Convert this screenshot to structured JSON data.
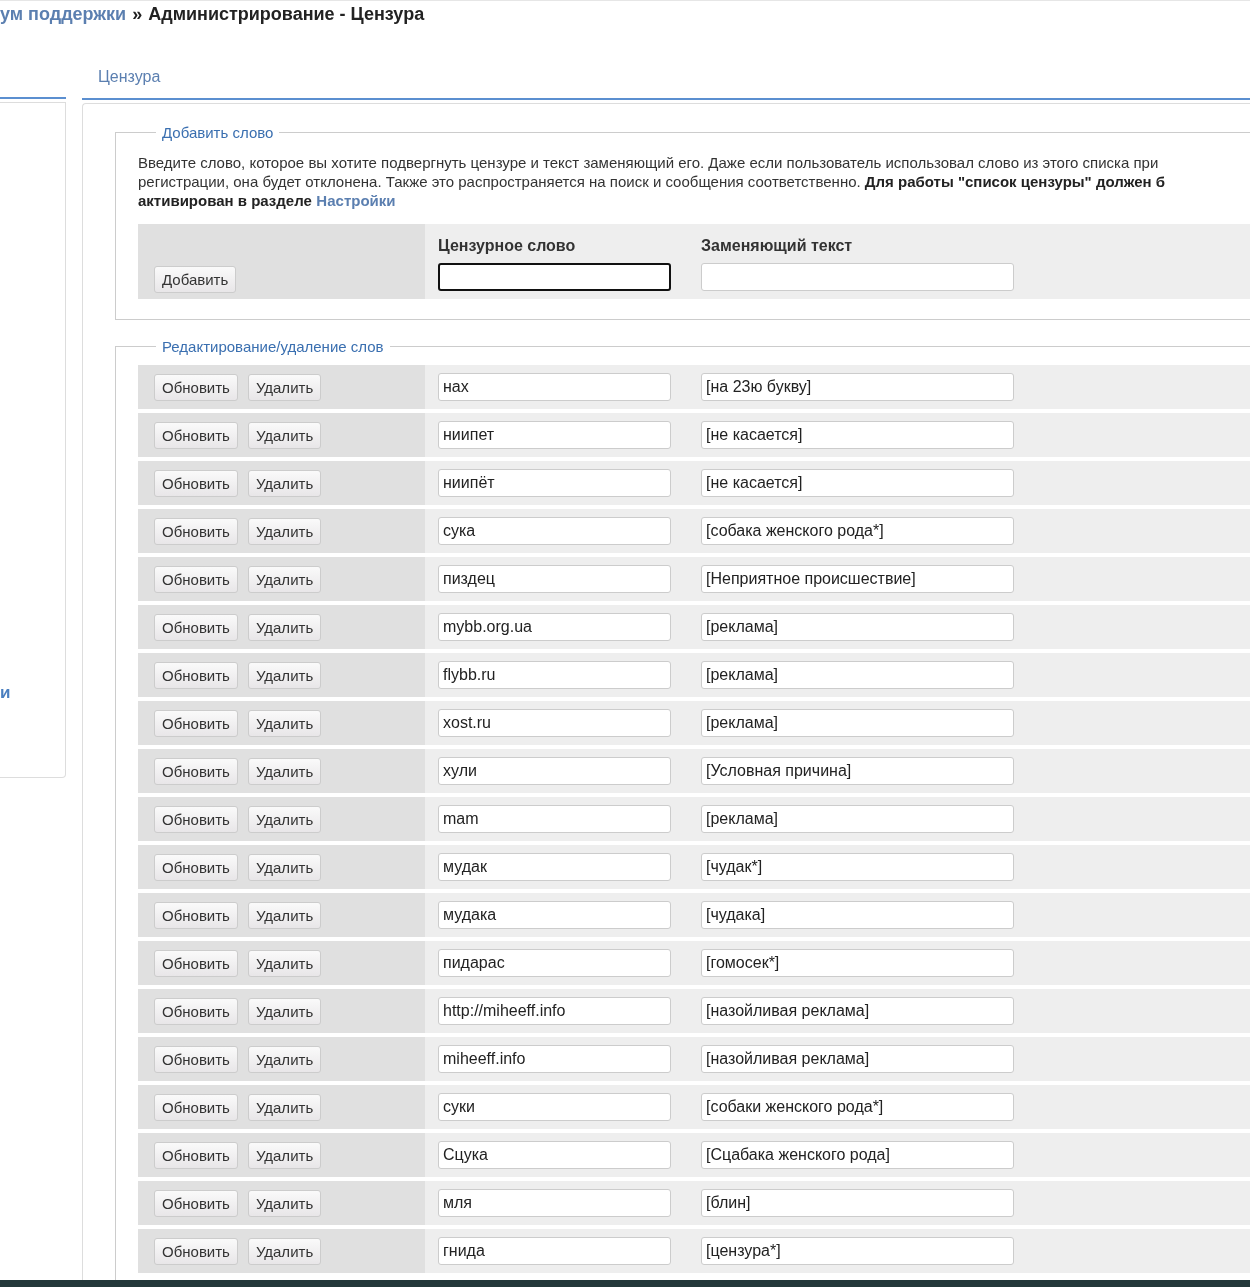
{
  "breadcrumb": {
    "link": "ум поддержки",
    "separator": "»",
    "current": "Администрирование - Цензура"
  },
  "sidebar": {
    "link": "и"
  },
  "tabs": [
    {
      "label": "Цензура",
      "selected": true
    }
  ],
  "add_section": {
    "legend": "Добавить слово",
    "description": [
      "Введите слово, которое вы хотите подвергнуть цензуре и текст заменяющий его. Даже если пользователь использовал слово из этого списка при",
      "регистрации, она будет отклонена. Также это распространяется на поиск и сообщения соответственно. **Для работы \"список цензуры\" должен б**",
      "**активирован в разделе**"
    ],
    "description_link": "Настройки",
    "button": "Добавить",
    "columns": [
      {
        "header": "Цензурное слово",
        "focused": true
      },
      {
        "header": "Заменяющий текст",
        "focused": false
      }
    ]
  },
  "edit_section": {
    "legend": "Редактирование/удаление слов",
    "rows": [
      {
        "update": "Обновить",
        "delete": "Удалить",
        "word": "нах",
        "replacement": "[на 23ю букву]"
      },
      {
        "update": "Обновить",
        "delete": "Удалить",
        "word": "ниипет",
        "replacement": "[не касается]"
      },
      {
        "update": "Обновить",
        "delete": "Удалить",
        "word": "ниипёт",
        "replacement": "[не касается]"
      },
      {
        "update": "Обновить",
        "delete": "Удалить",
        "word": "сука",
        "replacement": "[собака женского рода*]"
      },
      {
        "update": "Обновить",
        "delete": "Удалить",
        "word": "пиздец",
        "replacement": "[Неприятное происшествие]"
      },
      {
        "update": "Обновить",
        "delete": "Удалить",
        "word": "mybb.org.ua",
        "replacement": "[реклама]"
      },
      {
        "update": "Обновить",
        "delete": "Удалить",
        "word": "flybb.ru",
        "replacement": "[реклама]"
      },
      {
        "update": "Обновить",
        "delete": "Удалить",
        "word": "xost.ru",
        "replacement": "[реклама]"
      },
      {
        "update": "Обновить",
        "delete": "Удалить",
        "word": "хули",
        "replacement": "[Условная причина]"
      },
      {
        "update": "Обновить",
        "delete": "Удалить",
        "word": "mam",
        "replacement": "[реклама]"
      },
      {
        "update": "Обновить",
        "delete": "Удалить",
        "word": "мудак",
        "replacement": "[чудак*]"
      },
      {
        "update": "Обновить",
        "delete": "Удалить",
        "word": "мудака",
        "replacement": "[чудака]"
      },
      {
        "update": "Обновить",
        "delete": "Удалить",
        "word": "пидарас",
        "replacement": "[гомосек*]"
      },
      {
        "update": "Обновить",
        "delete": "Удалить",
        "word": "http://miheeff.info",
        "replacement": "[назойливая реклама]"
      },
      {
        "update": "Обновить",
        "delete": "Удалить",
        "word": "miheeff.info",
        "replacement": "[назойливая реклама]"
      },
      {
        "update": "Обновить",
        "delete": "Удалить",
        "word": "суки",
        "replacement": "[собаки женского рода*]"
      },
      {
        "update": "Обновить",
        "delete": "Удалить",
        "word": "Сцука",
        "replacement": "[Сцабака женского рода]"
      },
      {
        "update": "Обновить",
        "delete": "Удалить",
        "word": "мля",
        "replacement": "[блин]"
      },
      {
        "update": "Обновить",
        "delete": "Удалить",
        "word": "гнида",
        "replacement": "[цензура*]"
      }
    ]
  }
}
